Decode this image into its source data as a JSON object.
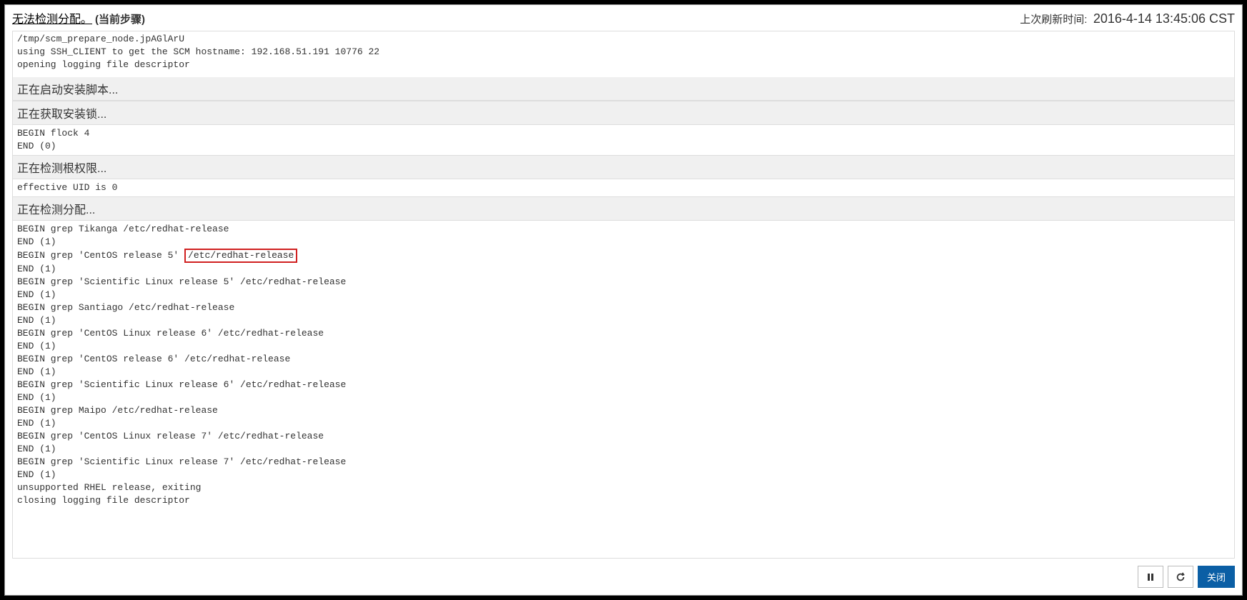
{
  "header": {
    "title_link": "无法检测分配。",
    "current_step": "(当前步骤)",
    "refresh_label": "上次刷新时间:",
    "refresh_time": "2016-4-14 13:45:06 CST"
  },
  "pre_lines": "/tmp/scm_prepare_node.jpAGlArU\nusing SSH_CLIENT to get the SCM hostname: 192.168.51.191 10776 22\nopening logging file descriptor",
  "sections": [
    {
      "title": "正在启动安装脚本...",
      "lines": []
    },
    {
      "title": "正在获取安装锁...",
      "lines": [
        {
          "text": "BEGIN flock 4"
        },
        {
          "text": "END (0)"
        }
      ]
    },
    {
      "title": "正在检测根权限...",
      "lines": [
        {
          "text": "effective UID is 0"
        }
      ]
    },
    {
      "title": "正在检测分配...",
      "lines": [
        {
          "text": "BEGIN grep Tikanga /etc/redhat-release"
        },
        {
          "text": "END (1)"
        },
        {
          "prefix": "BEGIN grep 'CentOS release 5' ",
          "highlight": "/etc/redhat-release"
        },
        {
          "text": "END (1)"
        },
        {
          "text": "BEGIN grep 'Scientific Linux release 5' /etc/redhat-release"
        },
        {
          "text": "END (1)"
        },
        {
          "text": "BEGIN grep Santiago /etc/redhat-release"
        },
        {
          "text": "END (1)"
        },
        {
          "text": "BEGIN grep 'CentOS Linux release 6' /etc/redhat-release"
        },
        {
          "text": "END (1)"
        },
        {
          "text": "BEGIN grep 'CentOS release 6' /etc/redhat-release"
        },
        {
          "text": "END (1)"
        },
        {
          "text": "BEGIN grep 'Scientific Linux release 6' /etc/redhat-release"
        },
        {
          "text": "END (1)"
        },
        {
          "text": "BEGIN grep Maipo /etc/redhat-release"
        },
        {
          "text": "END (1)"
        },
        {
          "text": "BEGIN grep 'CentOS Linux release 7' /etc/redhat-release"
        },
        {
          "text": "END (1)"
        },
        {
          "text": "BEGIN grep 'Scientific Linux release 7' /etc/redhat-release"
        },
        {
          "text": "END (1)"
        },
        {
          "text": "unsupported RHEL release, exiting"
        },
        {
          "text": "closing logging file descriptor"
        }
      ]
    }
  ],
  "footer": {
    "close_label": "关闭"
  }
}
